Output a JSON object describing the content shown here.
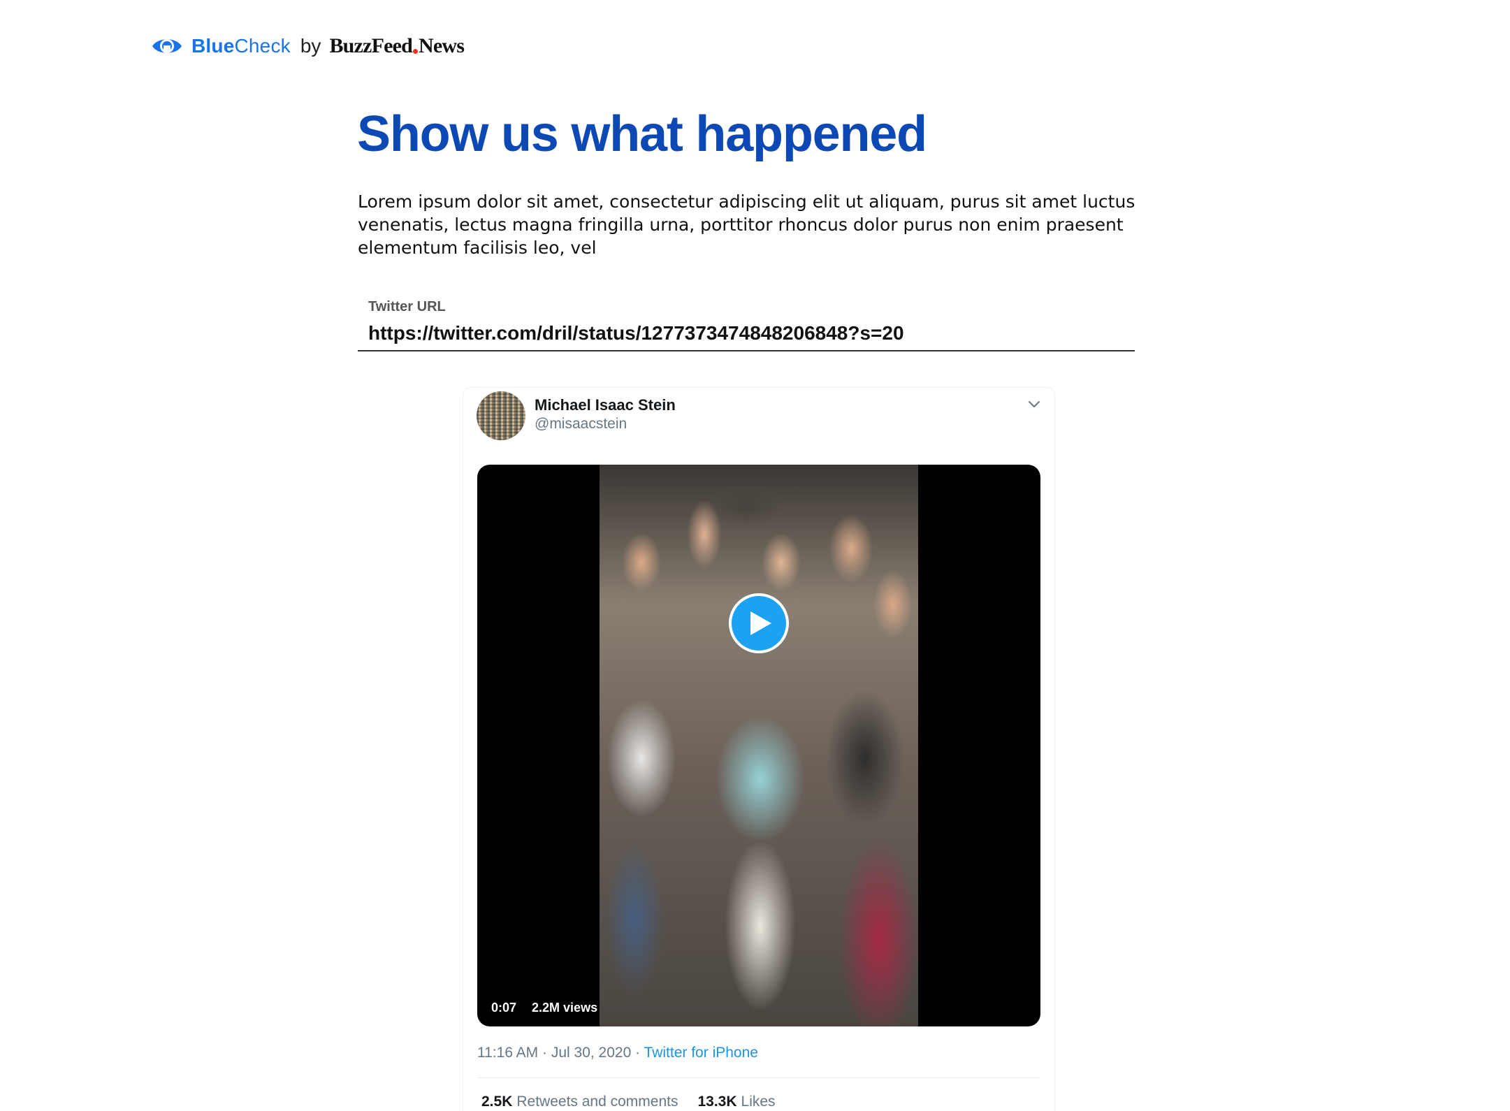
{
  "brand": {
    "name_bold": "Blue",
    "name_regular": "Check",
    "by": "by",
    "publisher_part1": "BuzzFeed",
    "publisher_part2": "News",
    "icon": "eye-icon",
    "accent_color": "#1a73e8"
  },
  "main": {
    "title": "Show us what happened",
    "intro": "Lorem ipsum dolor sit amet, consectetur adipiscing elit ut aliquam, purus sit amet luctus venenatis, lectus magna fringilla urna, porttitor rhoncus dolor purus non enim praesent elementum facilisis leo, vel",
    "title_color": "#0d49b5"
  },
  "url_field": {
    "label": "Twitter URL",
    "value": "https://twitter.com/dril/status/1277373474848206848?s=20"
  },
  "tweet": {
    "author_name": "Michael Isaac Stein",
    "author_handle": "@misaacstein",
    "menu_icon": "chevron-down-icon",
    "video": {
      "duration": "0:07",
      "views": "2.2M views",
      "play_icon": "play-icon",
      "play_color": "#1da1f2"
    },
    "timestamp": "11:16 AM · Jul 30, 2020 · ",
    "source": "Twitter for iPhone",
    "retweets_count": "2.5K",
    "retweets_label": "Retweets and comments",
    "likes_count": "13.3K",
    "likes_label": "Likes"
  }
}
